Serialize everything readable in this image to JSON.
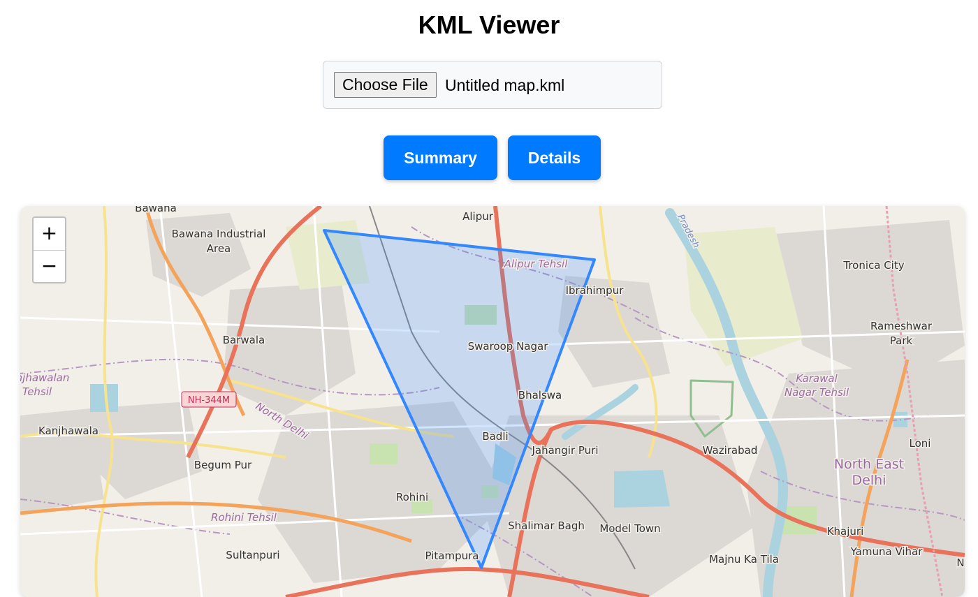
{
  "header": {
    "title": "KML Viewer"
  },
  "file_input": {
    "button_label": "Choose File",
    "file_name": "Untitled map.kml"
  },
  "buttons": {
    "summary": "Summary",
    "details": "Details"
  },
  "map": {
    "zoom_in": "+",
    "zoom_out": "−",
    "labels": {
      "bawana": "Bawana",
      "bawana_industrial": "Bawana Industrial",
      "area": "Area",
      "alipur": "Alipur",
      "alipur_tehsil": "Alipur Tehsil",
      "ibrahimpur": "Ibrahimpur",
      "pradesh": "Pradesh",
      "tronica_city": "Tronica City",
      "rameshwar": "Rameshwar",
      "park": "Park",
      "barwala": "Barwala",
      "swaroop_nagar": "Swaroop Nagar",
      "jhawalan": "njhawalan",
      "tehsil": "Tehsil",
      "nh344m": "NH-344M",
      "north_delhi": "North Delhi",
      "karawal": "Karawal",
      "nagar_tehsil": "Nagar Tehsil",
      "bhalswa": "Bhalswa",
      "kanjhawala": "Kanjhawala",
      "badli": "Badli",
      "jahangir_puri": "Jahangir Puri",
      "wazirabad": "Wazirabad",
      "loni": "Loni",
      "begum_pur": "Begum Pur",
      "north_east": "North East",
      "delhi": "Delhi",
      "rohini": "Rohini",
      "rohini_tehsil": "Rohini Tehsil",
      "shalimar_bagh": "Shalimar Bagh",
      "model_town": "Model Town",
      "khajuri": "Khajuri",
      "sultanpuri": "Sultanpuri",
      "pitampura": "Pitampura",
      "majnu_ka_tila": "Majnu Ka Tila",
      "yamuna_vihar": "Yamuna Vihar",
      "n": "N"
    },
    "polygon_stroke": "#3388ff",
    "polygon_fill": "#3388ff"
  }
}
